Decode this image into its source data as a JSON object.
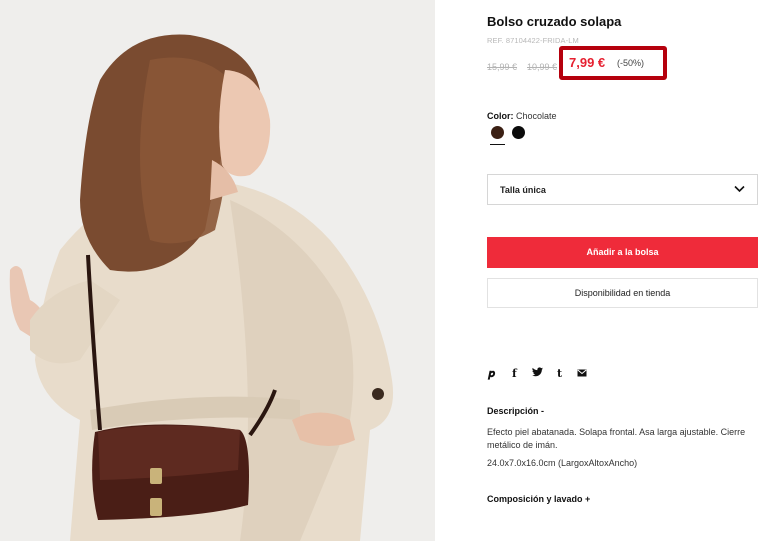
{
  "product": {
    "title": "Bolso cruzado solapa",
    "ref": "REF. 87104422-FRIDA-LM",
    "price_original": "15,99 €",
    "price_previous": "10,99 €",
    "price_current": "7,99 €",
    "discount": "(-50%)"
  },
  "color": {
    "label": "Color:",
    "selected": "Chocolate",
    "swatches": [
      {
        "name": "Chocolate",
        "hex": "#3b2014"
      },
      {
        "name": "Negro",
        "hex": "#0b0b0b"
      }
    ]
  },
  "size": {
    "selected": "Talla única"
  },
  "buttons": {
    "add_to_bag": "Añadir a la bolsa",
    "availability": "Disponibilidad en tienda"
  },
  "share": {
    "icons": [
      "pinterest-icon",
      "facebook-icon",
      "twitter-icon",
      "tumblr-icon",
      "email-icon"
    ]
  },
  "description": {
    "heading": "Descripción",
    "heading_toggle": "-",
    "text": "Efecto piel abatanada. Solapa frontal. Asa larga ajustable. Cierre metálico de imán.",
    "dimensions": "24.0x7.0x16.0cm (LargoxAltoxAncho)"
  },
  "composition": {
    "heading": "Composición y lavado",
    "toggle": "+"
  },
  "colors": {
    "accent": "#ef2b3a",
    "price_red": "#e62030",
    "highlight_border": "#b5000d"
  }
}
